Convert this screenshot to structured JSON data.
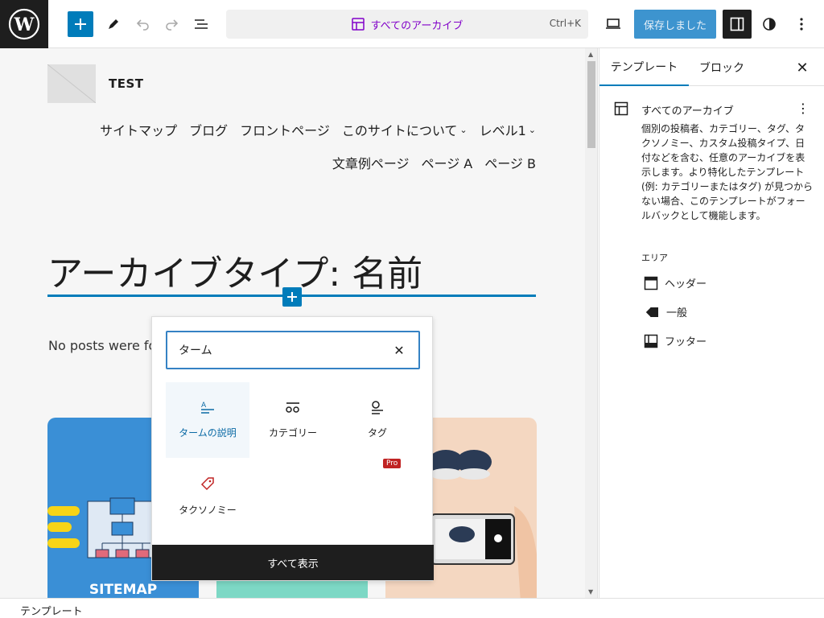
{
  "toolbar": {
    "doc_title": "すべてのアーカイブ",
    "shortcut": "Ctrl+K",
    "save_label": "保存しました"
  },
  "site": {
    "title": "TEST",
    "nav_row1": [
      "サイトマップ",
      "ブログ",
      "フロントページ",
      "このサイトについて",
      "レベル1"
    ],
    "nav_row2": [
      "文章例ページ",
      "ページ A",
      "ページ B"
    ]
  },
  "canvas": {
    "archive_title": "アーカイブタイプ: 名前",
    "no_posts": "No posts were fo",
    "card_label": "SITEMAP"
  },
  "inserter": {
    "search_value": "ターム",
    "blocks": [
      {
        "label": "タームの説明",
        "icon": "term-description-icon",
        "active": true
      },
      {
        "label": "カテゴリー",
        "icon": "categories-icon",
        "active": false
      },
      {
        "label": "タグ",
        "icon": "tag-icon",
        "active": false
      },
      {
        "label": "タクソノミー",
        "icon": "taxonomy-tag-icon",
        "active": false
      }
    ],
    "pro_badge": "Pro",
    "show_all": "すべて表示"
  },
  "sidebar": {
    "tabs": [
      "テンプレート",
      "ブロック"
    ],
    "template_name": "すべてのアーカイブ",
    "template_desc": "個別の投稿者、カテゴリー、タグ、タクソノミー、カスタム投稿タイプ、日付などを含む、任意のアーカイブを表示します。より特化したテンプレート (例: カテゴリーまたはタグ) が見つからない場合、このテンプレートがフォールバックとして機能します。",
    "areas_heading": "エリア",
    "areas": [
      "ヘッダー",
      "一般",
      "フッター"
    ]
  },
  "status": {
    "breadcrumb": "テンプレート"
  },
  "colors": {
    "accent": "#007cba",
    "doc_title": "#8100c9",
    "pro_badge": "#c02323"
  }
}
